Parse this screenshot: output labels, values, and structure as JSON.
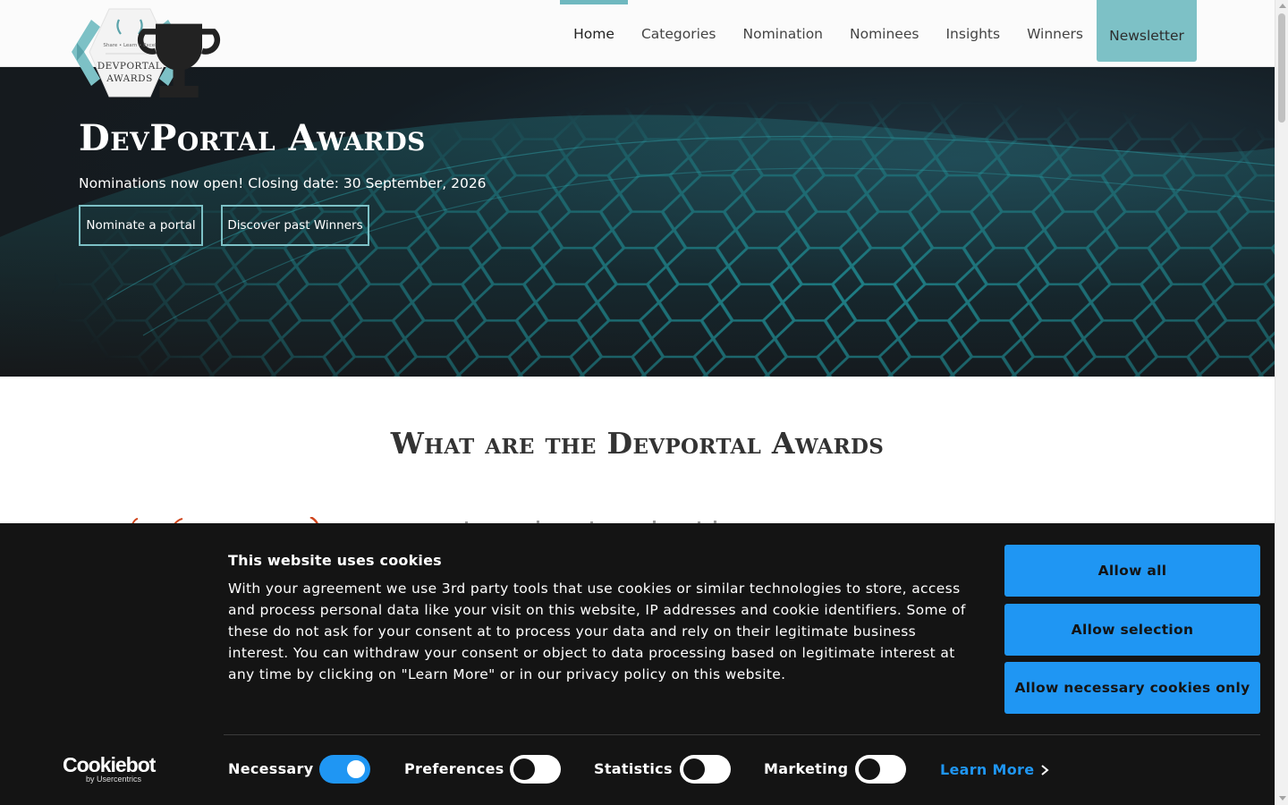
{
  "logo": {
    "tagline": "Share • Learn • Excel",
    "name_line1": "DEVPORTAL",
    "name_line2": "AWARDS"
  },
  "nav": {
    "items": [
      {
        "label": "Home",
        "active": true
      },
      {
        "label": "Categories"
      },
      {
        "label": "Nomination"
      },
      {
        "label": "Nominees"
      },
      {
        "label": "Insights"
      },
      {
        "label": "Winners"
      }
    ],
    "newsletter_label": "Newsletter"
  },
  "hero": {
    "title": "DevPortal Awards",
    "subtitle": "Nominations now open! Closing date: 30 September, 2026",
    "button_nominate": "Nominate a portal",
    "button_winners": "Discover past Winners"
  },
  "intro": {
    "heading": "What are the Devportal Awards"
  },
  "cookie_banner": {
    "title": "This website uses cookies",
    "text": "With your agreement we use 3rd party tools that use cookies or similar technologies to store, access and process personal data like your visit on this website, IP addresses and cookie identifiers. Some of these do not ask for your consent at to process your data and rely on their legitimate business interest. You can withdraw your consent or object to data processing based on legitimate interest at any time by clicking on \"Learn More\" or in our privacy policy on this website.",
    "allow_all": "Allow all",
    "allow_selection": "Allow selection",
    "allow_necessary": "Allow necessary cookies only",
    "brand": "Cookiebot",
    "brand_sub": "by Usercentrics",
    "toggles": [
      {
        "label": "Necessary",
        "enabled": true
      },
      {
        "label": "Preferences",
        "enabled": false
      },
      {
        "label": "Statistics",
        "enabled": false
      },
      {
        "label": "Marketing",
        "enabled": false
      }
    ],
    "learn_more": "Learn More"
  },
  "colors": {
    "accent_teal": "#7dc1c6",
    "cookie_blue": "#1f96f3",
    "banner_bg": "#141414"
  }
}
